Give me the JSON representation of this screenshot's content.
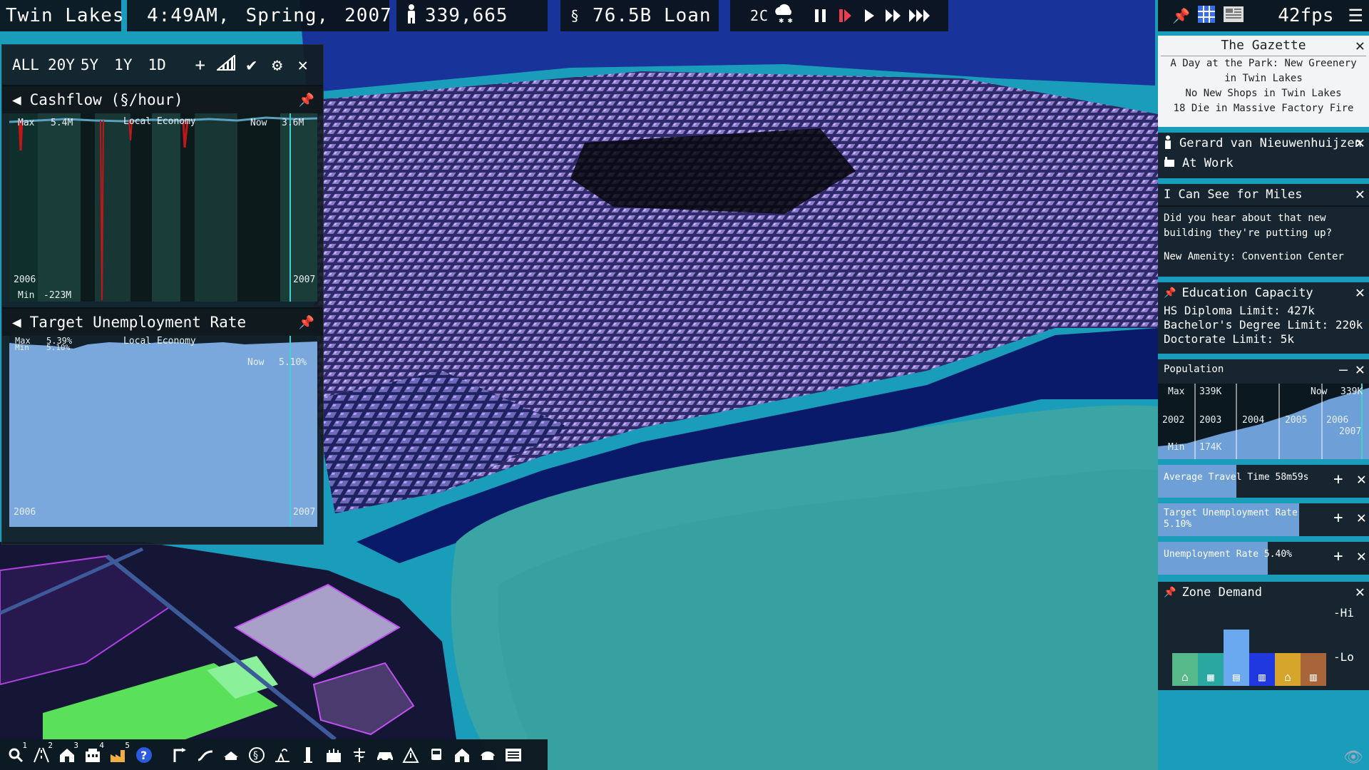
{
  "topbar": {
    "city_name": "Twin Lakes",
    "time": "4:49AM,",
    "season": "Spring,",
    "year": "2007",
    "population": "339,665",
    "money": "76.5B Loan",
    "temperature": "2C",
    "weather_icon": "snow-cloud-icon",
    "fps": "42fps",
    "speed_buttons": [
      "pause",
      "stop",
      "play",
      "fast",
      "fastest"
    ]
  },
  "chart_panel": {
    "range_tabs": [
      "ALL",
      "20Y",
      "5Y",
      "1Y",
      "1D"
    ],
    "tools": [
      "add",
      "bars",
      "check",
      "settings",
      "close"
    ],
    "cashflow": {
      "title": "Cashflow (§/hour)",
      "category": "Local Economy",
      "max_label": "Max",
      "max_value": "5.4M",
      "now_label": "Now",
      "now_value": "3.6M",
      "min_label": "Min",
      "min_value": "-223M",
      "start_year": "2006",
      "end_year": "2007"
    },
    "unemployment": {
      "title": "Target Unemployment Rate",
      "category": "Local Economy",
      "max_label": "Max",
      "max_value": "5.39%",
      "min_label": "Min",
      "min_value": "5.10%",
      "now_label": "Now",
      "now_value": "5.10%",
      "start_year": "2006",
      "end_year": "2007"
    }
  },
  "right_panel": {
    "gazette": {
      "title": "The Gazette",
      "headlines": [
        "A Day at the Park: New Greenery",
        "in Twin Lakes",
        "No New Shops in Twin Lakes",
        "18 Die in Massive Factory Fire"
      ]
    },
    "citizen": {
      "name": "Gerard van Nieuwenhuijzen",
      "status": "At Work"
    },
    "chat": {
      "title": "I Can See for Miles",
      "message": "Did you hear about that new building they're putting up?",
      "amenity": "New Amenity: Convention Center"
    },
    "education": {
      "title": "Education Capacity",
      "lines": [
        "HS Diploma Limit: 427k",
        "Bachelor's Degree Limit: 220k",
        "Doctorate Limit: 5k"
      ]
    },
    "population": {
      "title": "Population",
      "max_label": "Max",
      "max_value": "339K",
      "now_label": "Now",
      "now_value": "339K",
      "min_label": "Min",
      "min_value": "174K",
      "years": [
        "2002",
        "2003",
        "2004",
        "2005",
        "2006",
        "2007"
      ]
    },
    "travel_time": {
      "label": "Average Travel Time 58m59s",
      "level": 0.37
    },
    "target_unemployment": {
      "label": "Target Unemployment Rate",
      "value": "5.10%",
      "level": 0.67
    },
    "unemployment": {
      "label": "Unemployment Rate 5.40%",
      "level": 0.52
    },
    "zone_demand": {
      "title": "Zone Demand",
      "hi_label": "-Hi",
      "lo_label": "-Lo",
      "bars": [
        {
          "name": "residential-low",
          "level": 0.0,
          "color": "#55b98a"
        },
        {
          "name": "residential-high",
          "level": 0.0,
          "color": "#2aa7a0"
        },
        {
          "name": "commercial-low",
          "level": 0.55,
          "color": "#6aa8f0"
        },
        {
          "name": "commercial-high",
          "level": 0.0,
          "color": "#1f38e0"
        },
        {
          "name": "industrial-low",
          "level": 0.0,
          "color": "#d6a62c"
        },
        {
          "name": "industrial-high",
          "level": 0.0,
          "color": "#a8653a"
        }
      ]
    }
  },
  "bottom_toolbar": {
    "tools": [
      {
        "icon": "query-icon",
        "badge": "1"
      },
      {
        "icon": "roads-icon",
        "badge": "2"
      },
      {
        "icon": "zone-residential-icon",
        "badge": "3"
      },
      {
        "icon": "zone-commercial-icon",
        "badge": "4"
      },
      {
        "icon": "zone-industrial-icon",
        "badge": "5"
      },
      {
        "icon": "help-icon",
        "badge": ""
      },
      {
        "icon": "transit-icon",
        "badge": ""
      },
      {
        "icon": "pipe-icon",
        "badge": ""
      },
      {
        "icon": "government-icon",
        "badge": ""
      },
      {
        "icon": "budget-icon",
        "badge": ""
      },
      {
        "icon": "park-icon",
        "badge": ""
      },
      {
        "icon": "tower-icon",
        "badge": ""
      },
      {
        "icon": "education-icon",
        "badge": ""
      },
      {
        "icon": "health-icon",
        "badge": ""
      },
      {
        "icon": "car-icon",
        "badge": ""
      },
      {
        "icon": "hazard-icon",
        "badge": ""
      },
      {
        "icon": "bus-icon",
        "badge": ""
      },
      {
        "icon": "house-icon",
        "badge": ""
      },
      {
        "icon": "landmark-icon",
        "badge": ""
      },
      {
        "icon": "news-icon",
        "badge": ""
      }
    ]
  }
}
